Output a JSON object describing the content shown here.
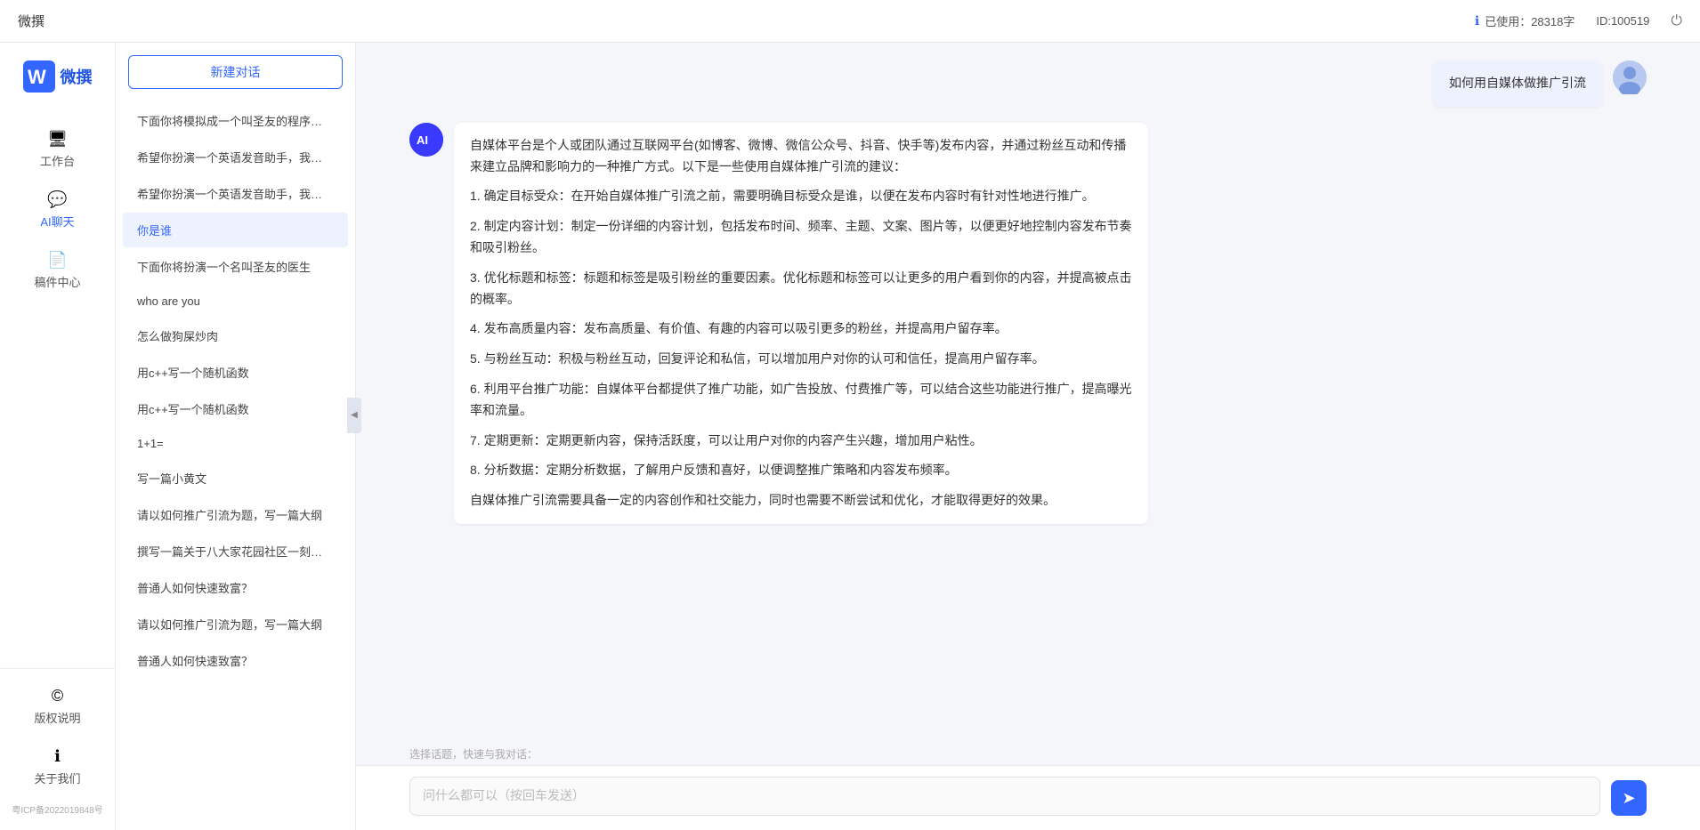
{
  "topbar": {
    "title": "微撰",
    "usage_label": "已使用：28318字",
    "usage_icon": "info-icon",
    "id_label": "ID:100519",
    "power_icon": "power-icon"
  },
  "logo": {
    "text": "微撰"
  },
  "nav": {
    "items": [
      {
        "id": "workbench",
        "label": "工作台",
        "icon": "🖥"
      },
      {
        "id": "ai-chat",
        "label": "AI聊天",
        "icon": "💬",
        "active": true
      },
      {
        "id": "components",
        "label": "稿件中心",
        "icon": "📄"
      }
    ],
    "bottom_items": [
      {
        "id": "copyright",
        "label": "版权说明",
        "icon": "©"
      },
      {
        "id": "about",
        "label": "关于我们",
        "icon": "ℹ"
      }
    ],
    "icp": "粤ICP备2022019848号"
  },
  "conv_list": {
    "new_btn_label": "新建对话",
    "items": [
      {
        "id": 1,
        "text": "下面你将模拟成一个叫圣友的程序员，我说..."
      },
      {
        "id": 2,
        "text": "希望你扮演一个英语发音助手，我提供给你..."
      },
      {
        "id": 3,
        "text": "希望你扮演一个英语发音助手，我提供给你..."
      },
      {
        "id": 4,
        "text": "你是谁",
        "active": true
      },
      {
        "id": 5,
        "text": "下面你将扮演一个名叫圣友的医生"
      },
      {
        "id": 6,
        "text": "who are you"
      },
      {
        "id": 7,
        "text": "怎么做狗屎炒肉"
      },
      {
        "id": 8,
        "text": "用c++写一个随机函数"
      },
      {
        "id": 9,
        "text": "用c++写一个随机函数"
      },
      {
        "id": 10,
        "text": "1+1="
      },
      {
        "id": 11,
        "text": "写一篇小黄文"
      },
      {
        "id": 12,
        "text": "请以如何推广引流为题，写一篇大纲"
      },
      {
        "id": 13,
        "text": "撰写一篇关于八大家花园社区一刻钟便民生..."
      },
      {
        "id": 14,
        "text": "普通人如何快速致富？"
      },
      {
        "id": 15,
        "text": "请以如何推广引流为题，写一篇大纲"
      },
      {
        "id": 16,
        "text": "普通人如何快速致富？"
      }
    ]
  },
  "chat": {
    "messages": [
      {
        "id": 1,
        "role": "user",
        "text": "如何用自媒体做推广引流",
        "avatar_type": "user"
      },
      {
        "id": 2,
        "role": "ai",
        "avatar_type": "ai",
        "paragraphs": [
          "自媒体平台是个人或团队通过互联网平台(如博客、微博、微信公众号、抖音、快手等)发布内容，并通过粉丝互动和传播来建立品牌和影响力的一种推广方式。以下是一些使用自媒体推广引流的建议：",
          "1. 确定目标受众：在开始自媒体推广引流之前，需要明确目标受众是谁，以便在发布内容时有针对性地进行推广。",
          "2. 制定内容计划：制定一份详细的内容计划，包括发布时间、频率、主题、文案、图片等，以便更好地控制内容发布节奏和吸引粉丝。",
          "3. 优化标题和标签：标题和标签是吸引粉丝的重要因素。优化标题和标签可以让更多的用户看到你的内容，并提高被点击的概率。",
          "4. 发布高质量内容：发布高质量、有价值、有趣的内容可以吸引更多的粉丝，并提高用户留存率。",
          "5. 与粉丝互动：积极与粉丝互动，回复评论和私信，可以增加用户对你的认可和信任，提高用户留存率。",
          "6. 利用平台推广功能：自媒体平台都提供了推广功能，如广告投放、付费推广等，可以结合这些功能进行推广，提高曝光率和流量。",
          "7. 定期更新：定期更新内容，保持活跃度，可以让用户对你的内容产生兴趣，增加用户粘性。",
          "8. 分析数据：定期分析数据，了解用户反馈和喜好，以便调整推广策略和内容发布频率。",
          "自媒体推广引流需要具备一定的内容创作和社交能力，同时也需要不断尝试和优化，才能取得更好的效果。"
        ]
      }
    ],
    "quick_select_label": "选择话题，快速与我对话：",
    "input_placeholder": "问什么都可以（按回车发送）"
  }
}
